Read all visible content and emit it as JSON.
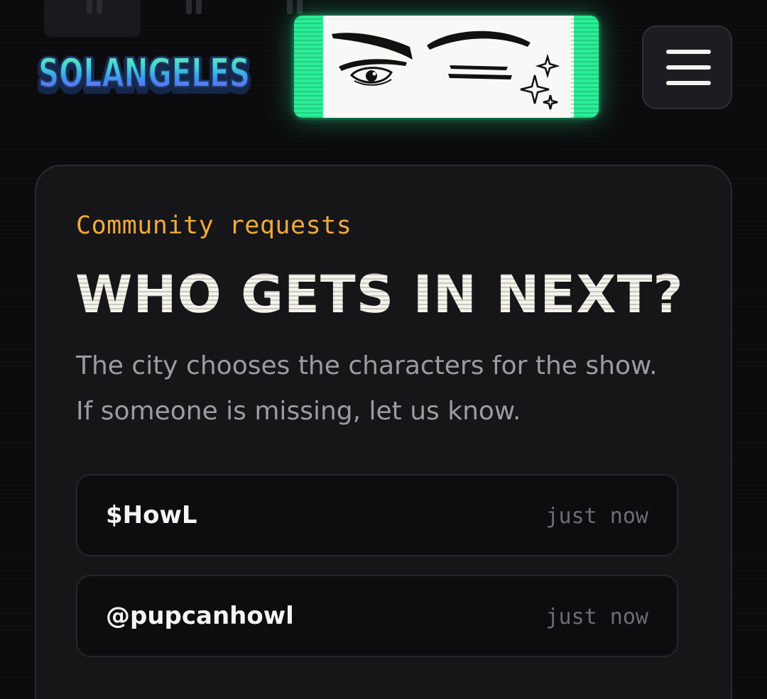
{
  "header": {
    "logo_text": "SOLANGELES",
    "menu_icon": "hamburger-menu-icon",
    "banner_image": "anime-eyes-illustration",
    "accent_color": "#2bee97"
  },
  "card": {
    "eyebrow": "Community requests",
    "title": "WHO GETS IN NEXT?",
    "description": "The city chooses the characters for the show. If someone is missing, let us know.",
    "requests": [
      {
        "name": "$HowL",
        "time": "just now"
      },
      {
        "name": "@pupcanhowl",
        "time": "just now"
      }
    ]
  },
  "colors": {
    "background": "#0b0b0d",
    "card": "#161619",
    "eyebrow": "#f0a93a",
    "title": "#f3f3ea",
    "description": "#9b9ba3"
  }
}
